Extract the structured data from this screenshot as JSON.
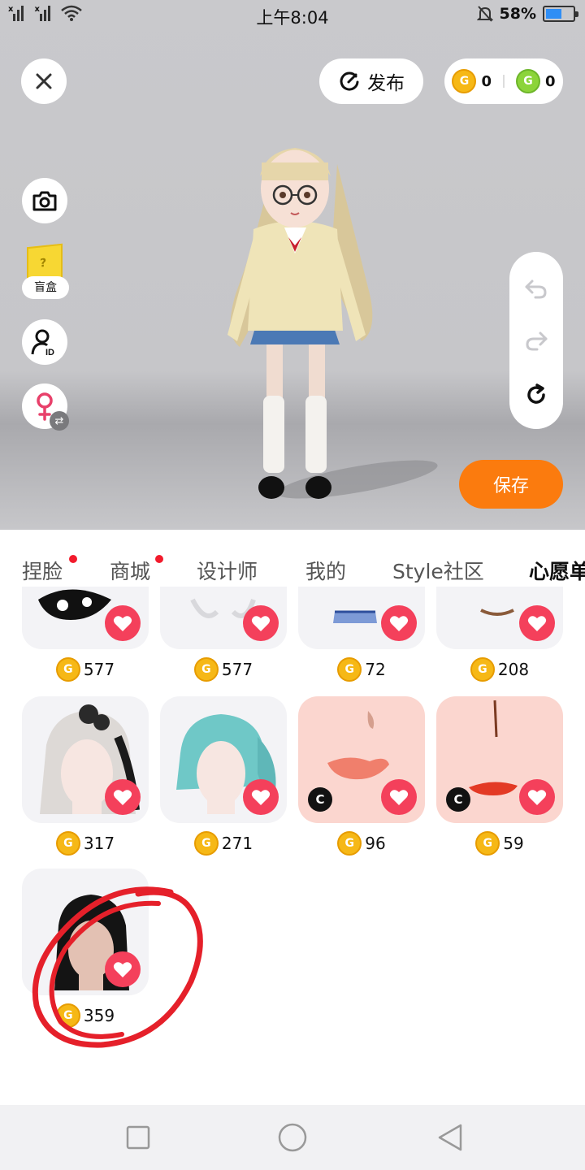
{
  "status_bar": {
    "time": "上午8:04",
    "battery": "58%",
    "battery_level": 0.58
  },
  "top_bar": {
    "publish_label": "发布",
    "gold_coins": "0",
    "green_coins": "0"
  },
  "side_tools": {
    "blind_box_label": "盲盒"
  },
  "save_label": "保存",
  "tabs": [
    {
      "label": "捏脸",
      "dot": true
    },
    {
      "label": "商城",
      "dot": true
    },
    {
      "label": "设计师",
      "dot": false
    },
    {
      "label": "我的",
      "dot": false
    },
    {
      "label": "Style社区",
      "dot": false
    },
    {
      "label": "心愿单",
      "active": true
    }
  ],
  "items": [
    {
      "price": "577"
    },
    {
      "price": "577"
    },
    {
      "price": "72"
    },
    {
      "price": "208"
    },
    {
      "price": "317"
    },
    {
      "price": "271"
    },
    {
      "price": "96"
    },
    {
      "price": "59"
    },
    {
      "price": "359"
    }
  ],
  "colors": {
    "accent": "#fb7b0e",
    "heart": "#f4405b",
    "coin": "#f6b816",
    "annotation": "#e5202a"
  }
}
